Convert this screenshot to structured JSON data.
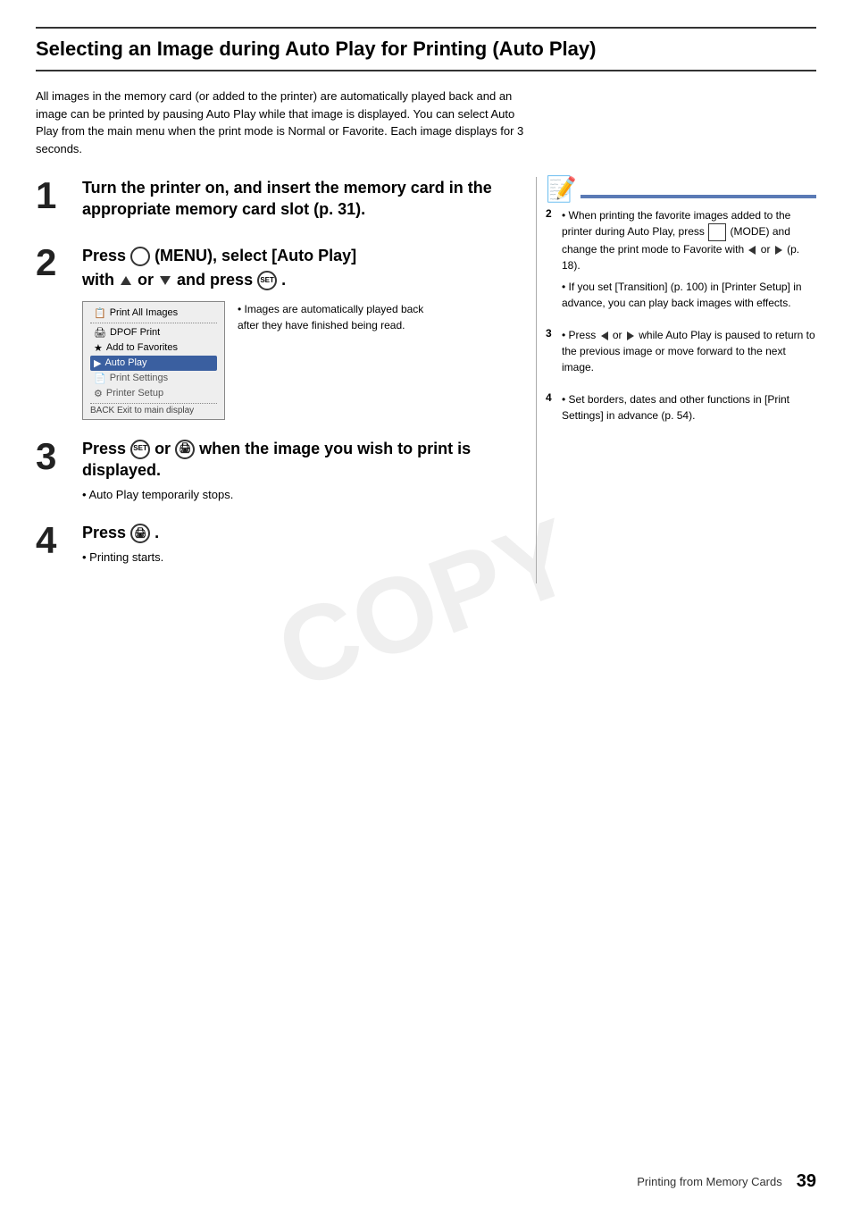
{
  "page": {
    "title": "Selecting an Image during Auto Play for Printing (Auto Play)",
    "intro": "All images in the memory card (or added to the printer) are automatically played back and an image can be printed by pausing Auto Play while that image is displayed. You can select Auto Play from the main menu when the print mode is Normal or Favorite. Each image displays for 3 seconds.",
    "footer": {
      "label": "Printing from Memory Cards",
      "page": "39"
    }
  },
  "steps": [
    {
      "number": "1",
      "text": "Turn the printer on, and insert the memory card in the appropriate memory card slot (p. 31)."
    },
    {
      "number": "2",
      "text_parts": [
        "Press",
        "(MENU), select [Auto Play] with",
        "or",
        "and press",
        "."
      ],
      "menu_items": [
        {
          "label": "Print All Images",
          "icon": "📋",
          "highlighted": false,
          "dotted": true
        },
        {
          "label": "DPOF Print",
          "icon": "🖨",
          "highlighted": false
        },
        {
          "label": "Add to Favorites",
          "icon": "★",
          "highlighted": false
        },
        {
          "label": "Auto Play",
          "icon": "▶",
          "highlighted": true
        },
        {
          "label": "Print Settings",
          "icon": "📄",
          "highlighted": false,
          "faded": true
        },
        {
          "label": "Printer Setup",
          "icon": "⚙",
          "highlighted": false,
          "faded": true
        }
      ],
      "menu_back": "BACK Exit to main display",
      "caption": "Images are automatically played back after they have finished being read."
    },
    {
      "number": "3",
      "text": "Press  or  when the image you wish to print is displayed.",
      "bullet": "Auto Play temporarily stops."
    },
    {
      "number": "4",
      "text": "Press  .",
      "bullet": "Printing starts."
    }
  ],
  "notes": [
    {
      "number": "2",
      "items": [
        "When printing the favorite images added to the printer during Auto Play, press  (MODE)  and change the print mode to Favorite with  or  (p. 18).",
        "If you set [Transition] (p. 100) in [Printer Setup] in advance, you can play back images with effects."
      ]
    },
    {
      "number": "3",
      "items": [
        "Press  or  while Auto Play is paused to return to the previous image or move forward to the next image."
      ]
    },
    {
      "number": "4",
      "items": [
        "Set borders, dates and other functions in [Print Settings] in advance (p. 54)."
      ]
    }
  ],
  "watermark": "COPY"
}
